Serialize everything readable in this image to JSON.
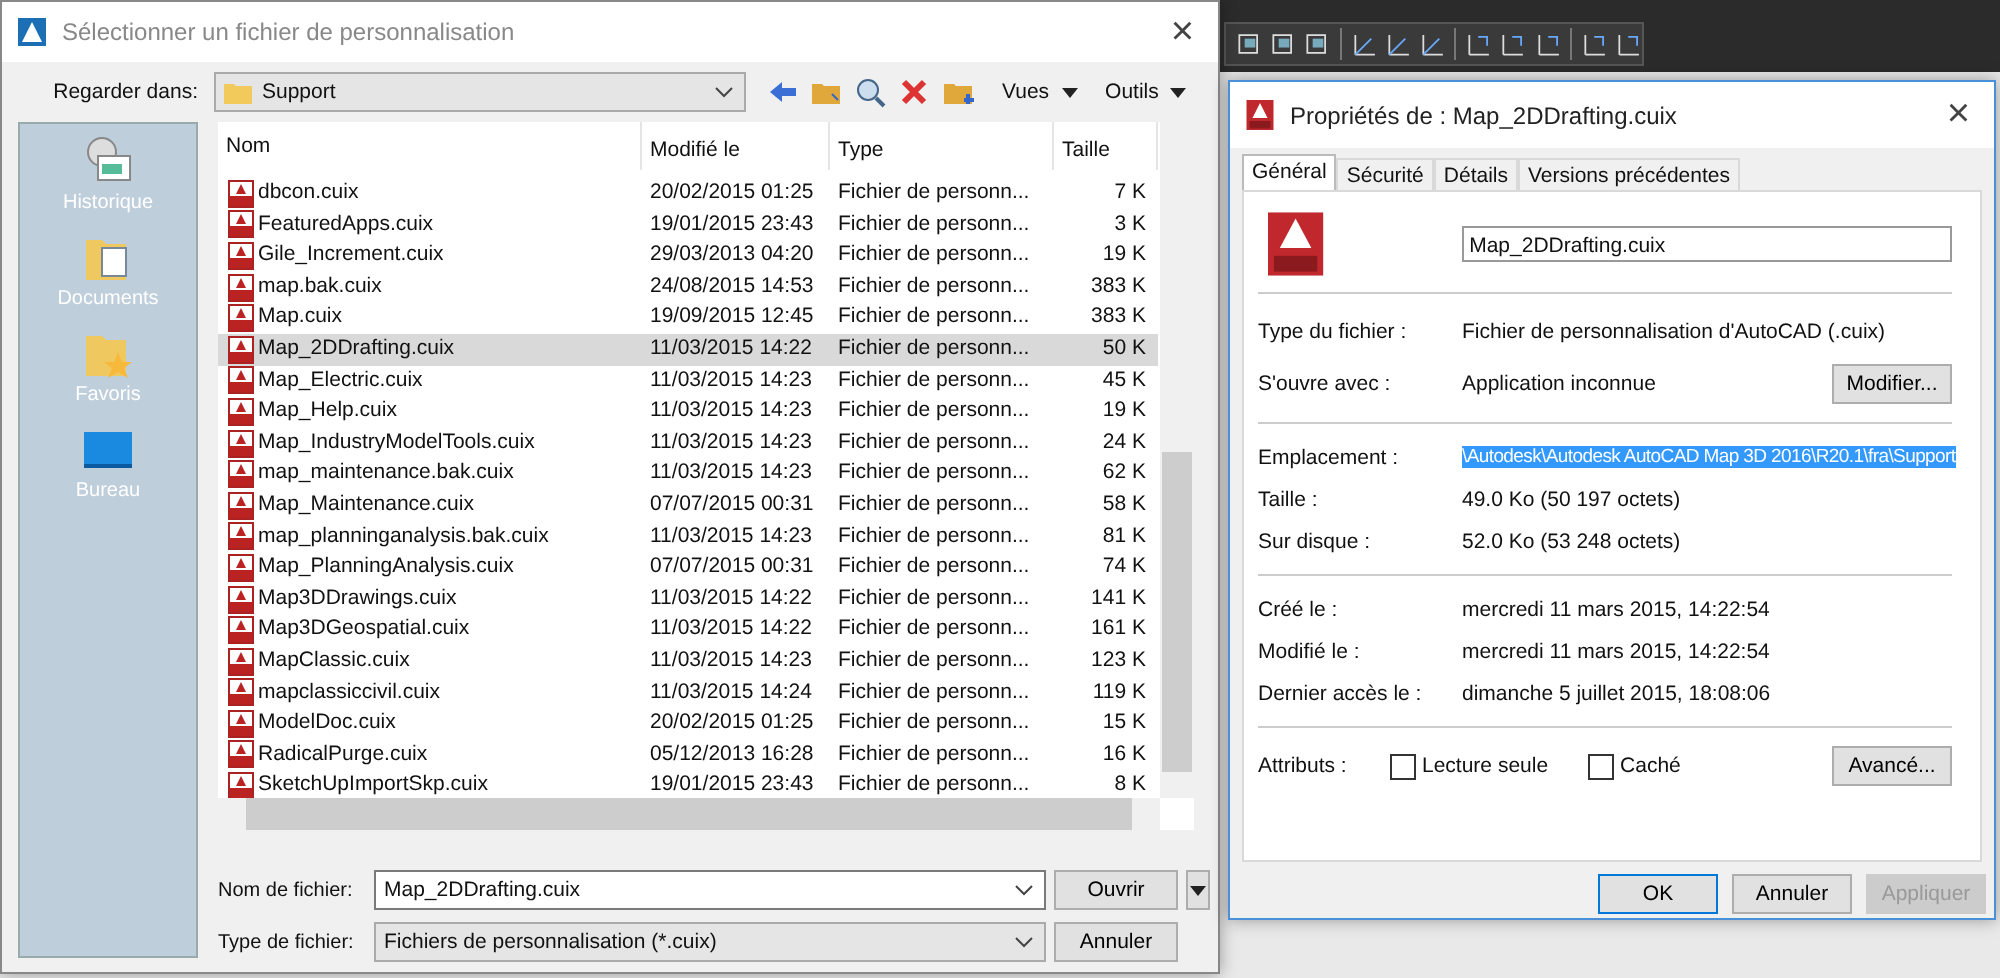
{
  "open_dialog": {
    "title": "Sélectionner un fichier de personnalisation",
    "close": "×",
    "look_in": {
      "label": "Regarder dans:",
      "value": "Support"
    },
    "toolbar": {
      "views": "Vues",
      "tools": "Outils"
    },
    "places": [
      {
        "label": "Historique",
        "kind": "history"
      },
      {
        "label": "Documents",
        "kind": "documents"
      },
      {
        "label": "Favoris",
        "kind": "favorites"
      },
      {
        "label": "Bureau",
        "kind": "desktop"
      }
    ],
    "columns": [
      "Nom",
      "Modifié le",
      "Type",
      "Taille"
    ],
    "rows": [
      {
        "name": "dbcon.cuix",
        "modified": "20/02/2015 01:25",
        "type": "Fichier de personn...",
        "size": "7 K",
        "selected": false
      },
      {
        "name": "FeaturedApps.cuix",
        "modified": "19/01/2015 23:43",
        "type": "Fichier de personn...",
        "size": "3 K",
        "selected": false
      },
      {
        "name": "Gile_Increment.cuix",
        "modified": "29/03/2013 04:20",
        "type": "Fichier de personn...",
        "size": "19 K",
        "selected": false
      },
      {
        "name": "map.bak.cuix",
        "modified": "24/08/2015 14:53",
        "type": "Fichier de personn...",
        "size": "383 K",
        "selected": false
      },
      {
        "name": "Map.cuix",
        "modified": "19/09/2015 12:45",
        "type": "Fichier de personn...",
        "size": "383 K",
        "selected": false
      },
      {
        "name": "Map_2DDrafting.cuix",
        "modified": "11/03/2015 14:22",
        "type": "Fichier de personn...",
        "size": "50 K",
        "selected": true
      },
      {
        "name": "Map_Electric.cuix",
        "modified": "11/03/2015 14:23",
        "type": "Fichier de personn...",
        "size": "45 K",
        "selected": false
      },
      {
        "name": "Map_Help.cuix",
        "modified": "11/03/2015 14:23",
        "type": "Fichier de personn...",
        "size": "19 K",
        "selected": false
      },
      {
        "name": "Map_IndustryModelTools.cuix",
        "modified": "11/03/2015 14:23",
        "type": "Fichier de personn...",
        "size": "24 K",
        "selected": false
      },
      {
        "name": "map_maintenance.bak.cuix",
        "modified": "11/03/2015 14:23",
        "type": "Fichier de personn...",
        "size": "62 K",
        "selected": false
      },
      {
        "name": "Map_Maintenance.cuix",
        "modified": "07/07/2015 00:31",
        "type": "Fichier de personn...",
        "size": "58 K",
        "selected": false
      },
      {
        "name": "map_planninganalysis.bak.cuix",
        "modified": "11/03/2015 14:23",
        "type": "Fichier de personn...",
        "size": "81 K",
        "selected": false
      },
      {
        "name": "Map_PlanningAnalysis.cuix",
        "modified": "07/07/2015 00:31",
        "type": "Fichier de personn...",
        "size": "74 K",
        "selected": false
      },
      {
        "name": "Map3DDrawings.cuix",
        "modified": "11/03/2015 14:22",
        "type": "Fichier de personn...",
        "size": "141 K",
        "selected": false
      },
      {
        "name": "Map3DGeospatial.cuix",
        "modified": "11/03/2015 14:22",
        "type": "Fichier de personn...",
        "size": "161 K",
        "selected": false
      },
      {
        "name": "MapClassic.cuix",
        "modified": "11/03/2015 14:23",
        "type": "Fichier de personn...",
        "size": "123 K",
        "selected": false
      },
      {
        "name": "mapclassiccivil.cuix",
        "modified": "11/03/2015 14:24",
        "type": "Fichier de personn...",
        "size": "119 K",
        "selected": false
      },
      {
        "name": "ModelDoc.cuix",
        "modified": "20/02/2015 01:25",
        "type": "Fichier de personn...",
        "size": "15 K",
        "selected": false
      },
      {
        "name": "RadicalPurge.cuix",
        "modified": "05/12/2013 16:28",
        "type": "Fichier de personn...",
        "size": "16 K",
        "selected": false
      },
      {
        "name": "SketchUpImportSkp.cuix",
        "modified": "19/01/2015 23:43",
        "type": "Fichier de personn...",
        "size": "8 K",
        "selected": false
      }
    ],
    "file_name": {
      "label": "Nom de fichier:",
      "value": "Map_2DDrafting.cuix"
    },
    "file_type": {
      "label": "Type de fichier:",
      "value": "Fichiers de personnalisation (*.cuix)"
    },
    "buttons": [
      "Ouvrir",
      "Annuler"
    ]
  },
  "properties_dialog": {
    "title": "Propriétés de : Map_2DDrafting.cuix",
    "close": "×",
    "tabs": [
      {
        "label": "Général",
        "selected": true
      },
      {
        "label": "Sécurité",
        "selected": false
      },
      {
        "label": "Détails",
        "selected": false
      },
      {
        "label": "Versions précédentes",
        "selected": false
      }
    ],
    "file_name": "Map_2DDrafting.cuix",
    "type": {
      "label": "Type du fichier :",
      "value": "Fichier de personnalisation d'AutoCAD (.cuix)"
    },
    "opens_with": {
      "label": "S'ouvre avec :",
      "value": "Application inconnue",
      "button": "Modifier..."
    },
    "location": {
      "label": "Emplacement :",
      "value": "\\Autodesk\\Autodesk AutoCAD Map 3D 2016\\R20.1\\fra\\Support",
      "selected": true
    },
    "size": {
      "label": "Taille :",
      "value": "49.0 Ko (50 197 octets)"
    },
    "size_on_disk": {
      "label": "Sur disque :",
      "value": "52.0 Ko (53 248 octets)"
    },
    "created": {
      "label": "Créé le :",
      "value": "mercredi 11 mars 2015, 14:22:54"
    },
    "modified": {
      "label": "Modifié le :",
      "value": "mercredi 11 mars 2015, 14:22:54"
    },
    "accessed": {
      "label": "Dernier accès le :",
      "value": "dimanche 5 juillet 2015, 18:08:06"
    },
    "attributes": {
      "label": "Attributs :",
      "read_only": {
        "label": "Lecture seule",
        "checked": false
      },
      "hidden": {
        "label": "Caché",
        "checked": false
      },
      "button": "Avancé..."
    },
    "buttons": [
      {
        "label": "OK",
        "disabled": false
      },
      {
        "label": "Annuler",
        "disabled": false
      },
      {
        "label": "Appliquer",
        "disabled": true
      }
    ]
  }
}
